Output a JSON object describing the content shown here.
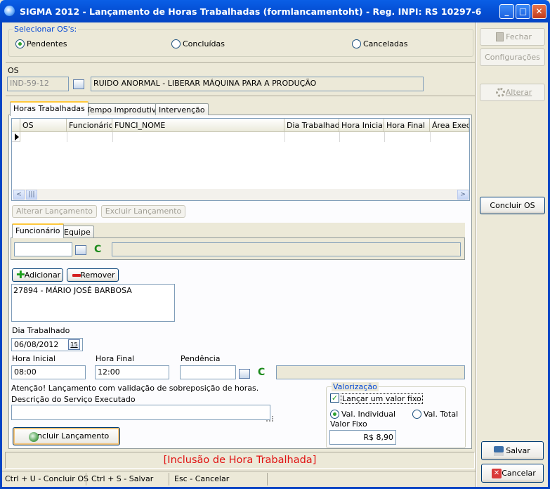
{
  "window": {
    "title": "SIGMA 2012 - Lançamento de Horas Trabalhadas  (formlancamentoht)  - Reg. INPI: RS 10297-6",
    "min_glyph": "_",
    "max_glyph": "□",
    "close_glyph": "✕"
  },
  "os_filter": {
    "legend": "Selecionar OS's:",
    "options": [
      {
        "label": "Pendentes",
        "selected": true
      },
      {
        "label": "Concluídas",
        "selected": false
      },
      {
        "label": "Canceladas",
        "selected": false
      }
    ]
  },
  "os": {
    "label": "OS",
    "code": "IND-59-12",
    "description": "RUIDO ANORMAL - LIBERAR MÁQUINA PARA A PRODUÇÃO"
  },
  "tabs": [
    "Horas Trabalhadas",
    "Tempo Improdutivo",
    "Intervenção"
  ],
  "grid": {
    "columns": [
      "OS",
      "Funcionários",
      "FUNCI_NOME",
      "Dia Trabalhado",
      "Hora Inicial",
      "Hora Final",
      "Área Exec"
    ],
    "left_arrow": "<",
    "thumb": "|||",
    "right_arrow": ">"
  },
  "grid_buttons": {
    "alterar": "Alterar Lançamento",
    "excluir": "Excluir Lançamento"
  },
  "worker_tabs": [
    "Funcionário",
    "Equipe"
  ],
  "worker_search": {
    "value": "",
    "refresh": "C",
    "name": ""
  },
  "list_buttons": {
    "add": "Adicionar",
    "remove": "Remover"
  },
  "workers": [
    "27894 - MÁRIO JOSÉ BARBOSA"
  ],
  "dia": {
    "label": "Dia Trabalhado",
    "value": "06/08/2012",
    "cal": "15"
  },
  "hora_inicial": {
    "label": "Hora Inicial",
    "value": "08:00"
  },
  "hora_final": {
    "label": "Hora Final",
    "value": "12:00"
  },
  "pendencia": {
    "label": "Pendência",
    "value": "",
    "refresh": "C",
    "name": ""
  },
  "warning": "Atenção! Lançamento com validação de sobreposição de horas.",
  "descricao": {
    "label": "Descrição do Serviço Executado",
    "value": ""
  },
  "valorizacao": {
    "legend": "Valorização",
    "fixo_label": "Lançar um valor fixo",
    "fixo_checked": true,
    "individual": "Val. Individual",
    "total": "Val. Total",
    "valor_label": "Valor Fixo",
    "valor": "R$ 8,90"
  },
  "incluir": "Incluir Lançamento",
  "status_message": "[Inclusão de Hora Trabalhada]",
  "shortcuts": [
    "Ctrl + U - Concluir OS",
    "Ctrl + S - Salvar",
    "Esc - Cancelar"
  ],
  "side": {
    "fechar": "Fechar",
    "config": "Configurações",
    "alterar": "Alterar",
    "concluir": "Concluir OS",
    "salvar": "Salvar",
    "cancelar": "Cancelar"
  },
  "colors": {
    "accent": "#0046d5",
    "status": "#e01010",
    "titlebar": "#0552d8"
  }
}
